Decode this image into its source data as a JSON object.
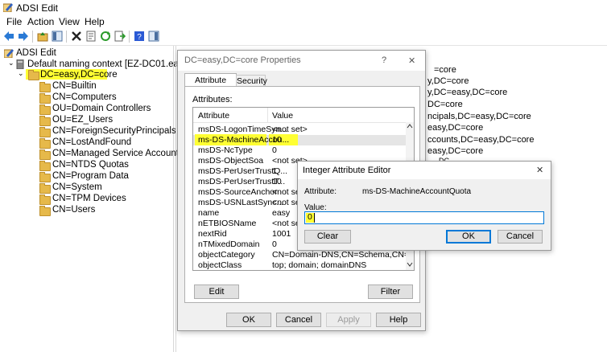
{
  "window": {
    "title": "ADSI Edit"
  },
  "menu": [
    "File",
    "Action",
    "View",
    "Help"
  ],
  "tree": {
    "root": "ADSI Edit",
    "context": "Default naming context [EZ-DC01.easy.core]",
    "domain": "DC=easy,DC=core",
    "children": [
      "CN=Builtin",
      "CN=Computers",
      "OU=Domain Controllers",
      "OU=EZ_Users",
      "CN=ForeignSecurityPrincipals",
      "CN=LostAndFound",
      "CN=Managed Service Accounts",
      "CN=NTDS Quotas",
      "CN=Program Data",
      "CN=System",
      "CN=TPM Devices",
      "CN=Users"
    ]
  },
  "right_pane_fragments": [
    "=core",
    "y,DC=core",
    "y,DC=easy,DC=core",
    "DC=core",
    "ncipals,DC=easy,DC=core",
    "easy,DC=core",
    "ccounts,DC=easy,DC=core",
    "easy,DC=core",
    "DC"
  ],
  "properties_dialog": {
    "title": "DC=easy,DC=core Properties",
    "help_glyph": "?",
    "close_glyph": "✕",
    "tabs": [
      "Attribute Editor",
      "Security"
    ],
    "attributes_label": "Attributes:",
    "columns": [
      "Attribute",
      "Value"
    ],
    "rows": [
      [
        "msDS-LogonTimeSyn...",
        "<not set>"
      ],
      [
        "ms-DS-MachineAccou...",
        "10"
      ],
      [
        "msDS-NcType",
        "0"
      ],
      [
        "msDS-ObjectSoa",
        "<not set>"
      ],
      [
        "msDS-PerUserTrustQ...",
        "1"
      ],
      [
        "msDS-PerUserTrustT...",
        "10"
      ],
      [
        "msDS-SourceAnchor",
        "<not set>"
      ],
      [
        "msDS-USNLastSync...",
        "<not set>"
      ],
      [
        "name",
        "easy"
      ],
      [
        "nETBIOSName",
        "<not set>"
      ],
      [
        "nextRid",
        "1001"
      ],
      [
        "nTMixedDomain",
        "0"
      ],
      [
        "objectCategory",
        "CN=Domain-DNS,CN=Schema,CN=Configura"
      ],
      [
        "objectClass",
        "top; domain; domainDNS"
      ]
    ],
    "edit": "Edit",
    "filter": "Filter",
    "ok": "OK",
    "cancel": "Cancel",
    "apply": "Apply",
    "help": "Help"
  },
  "int_editor": {
    "title": "Integer Attribute Editor",
    "close_glyph": "✕",
    "attribute_label": "Attribute:",
    "attribute_value": "ms-DS-MachineAccountQuota",
    "value_label": "Value:",
    "value": "0",
    "clear": "Clear",
    "ok": "OK",
    "cancel": "Cancel"
  },
  "colors": {
    "highlight": "#ffff33",
    "accent": "#0078d7",
    "folder": "#e6b94a"
  }
}
